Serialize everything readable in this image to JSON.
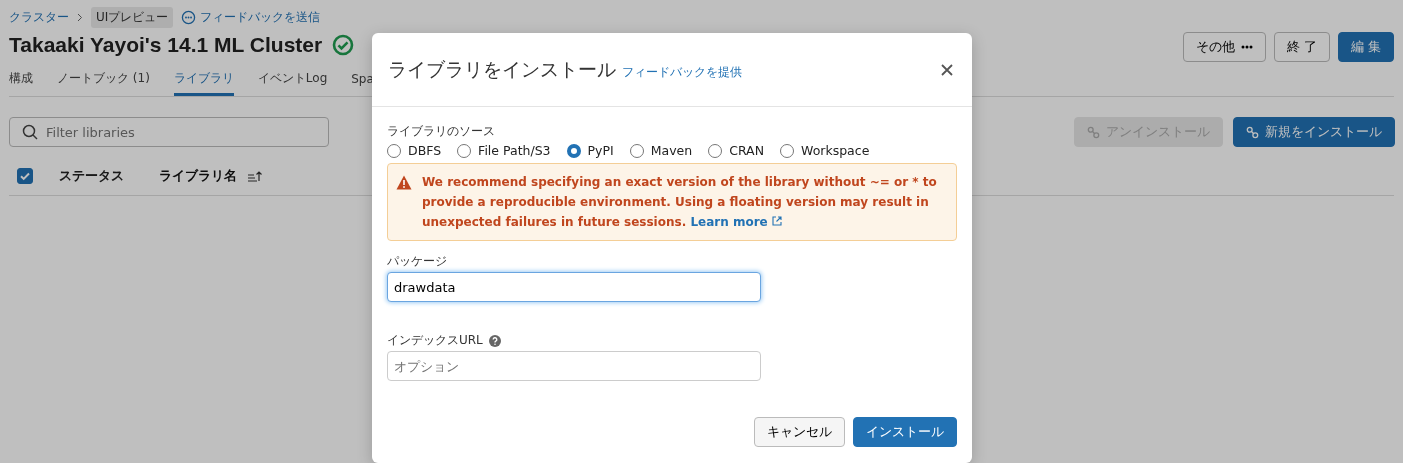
{
  "breadcrumbs": [
    {
      "label": "クラスター",
      "kind": "link"
    },
    {
      "label": "UIプレビュー",
      "kind": "badge"
    }
  ],
  "feedback_link": "フィードバックを送信",
  "title": "Takaaki Yayoi's 14.1 ML Cluster",
  "status": {
    "running": true
  },
  "header_buttons": [
    {
      "label": "その他",
      "kind": "more"
    },
    {
      "label": "終 了",
      "kind": "secondary"
    },
    {
      "label": "編 集",
      "kind": "primary"
    }
  ],
  "tabs": [
    {
      "label": "構成",
      "selected": false
    },
    {
      "label": "ノートブック (1)",
      "selected": false
    },
    {
      "label": "ライブラリ",
      "selected": true
    },
    {
      "label": "イベントLog",
      "selected": false
    },
    {
      "label": "Spa",
      "selected": false
    }
  ],
  "filter": {
    "placeholder": "Filter libraries"
  },
  "toolbar_buttons": [
    {
      "label": "アンインストール",
      "disabled": true
    },
    {
      "label": "新規をインストール",
      "disabled": false
    }
  ],
  "table": {
    "select_all": {
      "checked": true
    },
    "columns": [
      {
        "label": "ステータス",
        "sorted": false
      },
      {
        "label": "ライブラリ名",
        "sorted": true
      }
    ]
  },
  "dialog": {
    "title": "ライブラリをインストール",
    "feedback_link": "フィードバックを提供",
    "source_label": "ライブラリのソース",
    "sources": [
      {
        "label": "DBFS",
        "selected": false
      },
      {
        "label": "File Path/S3",
        "selected": false
      },
      {
        "label": "PyPI",
        "selected": true
      },
      {
        "label": "Maven",
        "selected": false
      },
      {
        "label": "CRAN",
        "selected": false
      },
      {
        "label": "Workspace",
        "selected": false
      }
    ],
    "warning": {
      "text": "We recommend specifying an exact version of the library without ~= or * to provide a reproducible environment. Using a floating version may result in unexpected failures in future sessions.",
      "link": "Learn more"
    },
    "package": {
      "label": "パッケージ",
      "value": "drawdata",
      "focused": true
    },
    "index_url": {
      "label": "インデックスURL",
      "placeholder": "オプション"
    },
    "buttons": [
      {
        "label": "キャンセル",
        "kind": "secondary"
      },
      {
        "label": "インストール",
        "kind": "primary"
      }
    ]
  }
}
